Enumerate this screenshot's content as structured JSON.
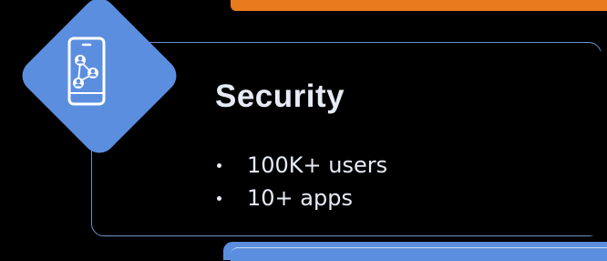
{
  "card": {
    "title": "Security",
    "bullets": [
      "100K+ users",
      "10+ apps"
    ],
    "icon": "mobile-network-users-icon"
  },
  "colors": {
    "background": "#000000",
    "accent_orange": "#e87b1e",
    "accent_blue": "#5b8ede",
    "frame_border": "#6d93c9",
    "text": "#e6ebf5"
  }
}
